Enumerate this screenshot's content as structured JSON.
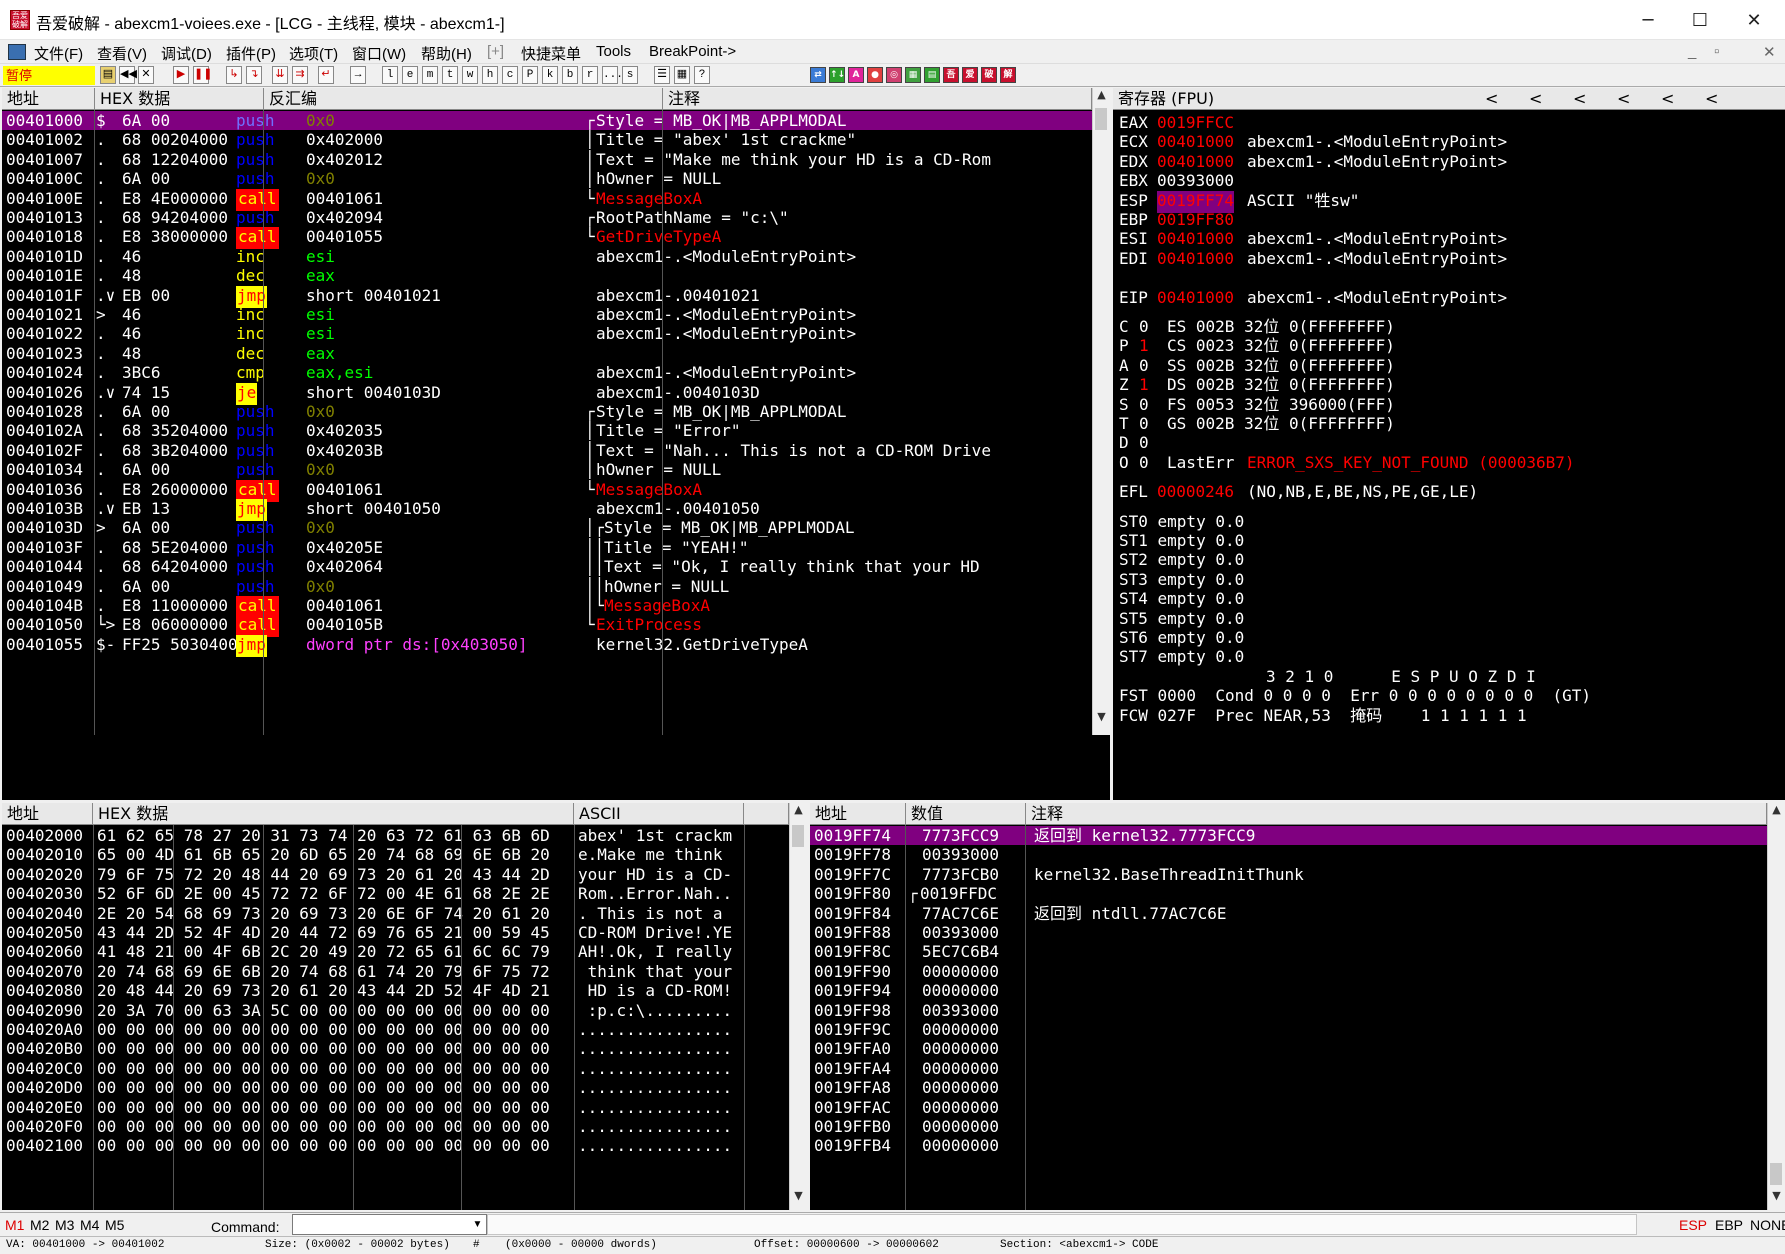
{
  "window": {
    "title": "吾爱破解 - abexcm1-voiees.exe - [LCG - 主线程, 模块 - abexcm1-]",
    "icon_text": "吾爱\n破解",
    "min": "─",
    "max": "☐",
    "close": "✕"
  },
  "menu": {
    "items": [
      "文件(F)",
      "查看(V)",
      "调试(D)",
      "插件(P)",
      "选项(T)",
      "窗口(W)",
      "帮助(H)",
      "[+]",
      "快捷菜单",
      "Tools",
      "BreakPoint->"
    ],
    "mdi_min": "_",
    "mdi_restore": "▫",
    "mdi_close": "✕"
  },
  "toolbar": {
    "status": "暂停",
    "letter_buttons": [
      "l",
      "e",
      "m",
      "t",
      "w",
      "h",
      "c",
      "P",
      "k",
      "b",
      "r",
      "...",
      "s"
    ],
    "plugin_labels": [
      "A",
      "吾",
      "爱",
      "破",
      "解"
    ]
  },
  "disasm": {
    "headers": [
      "地址",
      "HEX 数据",
      "反汇编",
      "注释"
    ],
    "rows": [
      {
        "addr": "00401000",
        "mark": "$",
        "hex": "6A 00",
        "mn": "push",
        "op": "0x0",
        "cm": "Style = MB_OK|MB_APPLMODAL",
        "br": "┌"
      },
      {
        "addr": "00401002",
        "mark": ".",
        "hex": "68 00204000",
        "mn": "push",
        "op": "0x402000",
        "cm": "Title = \"abex' 1st crackme\"",
        "br": "│"
      },
      {
        "addr": "00401007",
        "mark": ".",
        "hex": "68 12204000",
        "mn": "push",
        "op": "0x402012",
        "cm": "Text = \"Make me think your HD is a CD-Rom",
        "br": "│"
      },
      {
        "addr": "0040100C",
        "mark": ".",
        "hex": "6A 00",
        "mn": "push",
        "op": "0x0",
        "cm": "hOwner = NULL",
        "br": "│"
      },
      {
        "addr": "0040100E",
        "mark": ".",
        "hex": "E8 4E000000",
        "mn": "call",
        "op": "00401061",
        "cm": "MessageBoxA",
        "br": "└"
      },
      {
        "addr": "00401013",
        "mark": ".",
        "hex": "68 94204000",
        "mn": "push",
        "op": "0x402094",
        "cm": "RootPathName = \"c:\\\"",
        "br": "┌"
      },
      {
        "addr": "00401018",
        "mark": ".",
        "hex": "E8 38000000",
        "mn": "call",
        "op": "00401055",
        "cm": "GetDriveTypeA",
        "br": "└"
      },
      {
        "addr": "0040101D",
        "mark": ".",
        "hex": "46",
        "mn": "inc",
        "op": "esi",
        "cm": "abexcm1-.<ModuleEntryPoint>",
        "br": ""
      },
      {
        "addr": "0040101E",
        "mark": ".",
        "hex": "48",
        "mn": "dec",
        "op": "eax",
        "cm": "",
        "br": ""
      },
      {
        "addr": "0040101F",
        "mark": ".∨",
        "hex": "EB 00",
        "mn": "jmp",
        "op": "short 00401021",
        "cm": "abexcm1-.00401021",
        "br": ""
      },
      {
        "addr": "00401021",
        "mark": ">",
        "hex": "46",
        "mn": "inc",
        "op": "esi",
        "cm": "abexcm1-.<ModuleEntryPoint>",
        "br": ""
      },
      {
        "addr": "00401022",
        "mark": ".",
        "hex": "46",
        "mn": "inc",
        "op": "esi",
        "cm": "abexcm1-.<ModuleEntryPoint>",
        "br": ""
      },
      {
        "addr": "00401023",
        "mark": ".",
        "hex": "48",
        "mn": "dec",
        "op": "eax",
        "cm": "",
        "br": ""
      },
      {
        "addr": "00401024",
        "mark": ".",
        "hex": "3BC6",
        "mn": "cmp",
        "op": "eax,esi",
        "cm": "abexcm1-.<ModuleEntryPoint>",
        "br": ""
      },
      {
        "addr": "00401026",
        "mark": ".∨",
        "hex": "74 15",
        "mn": "je",
        "op": "short 0040103D",
        "cm": "abexcm1-.0040103D",
        "br": ""
      },
      {
        "addr": "00401028",
        "mark": ".",
        "hex": "6A 00",
        "mn": "push",
        "op": "0x0",
        "cm": "Style = MB_OK|MB_APPLMODAL",
        "br": "┌"
      },
      {
        "addr": "0040102A",
        "mark": ".",
        "hex": "68 35204000",
        "mn": "push",
        "op": "0x402035",
        "cm": "Title = \"Error\"",
        "br": "│"
      },
      {
        "addr": "0040102F",
        "mark": ".",
        "hex": "68 3B204000",
        "mn": "push",
        "op": "0x40203B",
        "cm": "Text = \"Nah... This is not a CD-ROM Drive",
        "br": "│"
      },
      {
        "addr": "00401034",
        "mark": ".",
        "hex": "6A 00",
        "mn": "push",
        "op": "0x0",
        "cm": "hOwner = NULL",
        "br": "│"
      },
      {
        "addr": "00401036",
        "mark": ".",
        "hex": "E8 26000000",
        "mn": "call",
        "op": "00401061",
        "cm": "MessageBoxA",
        "br": "└"
      },
      {
        "addr": "0040103B",
        "mark": ".∨",
        "hex": "EB 13",
        "mn": "jmp",
        "op": "short 00401050",
        "cm": "abexcm1-.00401050",
        "br": ""
      },
      {
        "addr": "0040103D",
        "mark": ">",
        "hex": "6A 00",
        "mn": "push",
        "op": "0x0",
        "cm": "Style = MB_OK|MB_APPLMODAL",
        "br": "│┌"
      },
      {
        "addr": "0040103F",
        "mark": ".",
        "hex": "68 5E204000",
        "mn": "push",
        "op": "0x40205E",
        "cm": "Title = \"YEAH!\"",
        "br": "││"
      },
      {
        "addr": "00401044",
        "mark": ".",
        "hex": "68 64204000",
        "mn": "push",
        "op": "0x402064",
        "cm": "Text = \"Ok, I really think that your HD",
        "br": "││"
      },
      {
        "addr": "00401049",
        "mark": ".",
        "hex": "6A 00",
        "mn": "push",
        "op": "0x0",
        "cm": "hOwner = NULL",
        "br": "││"
      },
      {
        "addr": "0040104B",
        "mark": ".",
        "hex": "E8 11000000",
        "mn": "call",
        "op": "00401061",
        "cm": "MessageBoxA",
        "br": "│└"
      },
      {
        "addr": "00401050",
        "mark": "└>",
        "hex": "E8 06000000",
        "mn": "call",
        "op": "0040105B",
        "cm": "ExitProcess",
        "br": "└"
      },
      {
        "addr": "00401055",
        "mark": "$-",
        "hex": "FF25 50304000",
        "mn": "jmp",
        "op": "dword ptr ds:[0x403050]",
        "cm": "kernel32.GetDriveTypeA",
        "br": ""
      }
    ]
  },
  "registers": {
    "header": "寄存器 (FPU)",
    "arrows": [
      "<",
      "<",
      "<",
      "<",
      "<",
      "<"
    ],
    "lines": [
      {
        "n": "EAX",
        "v": "0019FFCC",
        "d": "",
        "red": true
      },
      {
        "n": "ECX",
        "v": "00401000",
        "d": "abexcm1-.<ModuleEntryPoint>",
        "red": true
      },
      {
        "n": "EDX",
        "v": "00401000",
        "d": "abexcm1-.<ModuleEntryPoint>",
        "red": true
      },
      {
        "n": "EBX",
        "v": "00393000",
        "d": "",
        "red": false
      },
      {
        "n": "ESP",
        "v": "0019FF74",
        "d": "ASCII \"牲sw\"",
        "red": true,
        "hl": true
      },
      {
        "n": "EBP",
        "v": "0019FF80",
        "d": "",
        "red": true
      },
      {
        "n": "ESI",
        "v": "00401000",
        "d": "abexcm1-.<ModuleEntryPoint>",
        "red": true
      },
      {
        "n": "EDI",
        "v": "00401000",
        "d": "abexcm1-.<ModuleEntryPoint>",
        "red": true
      },
      {
        "n": "",
        "v": "",
        "d": "",
        "red": false
      },
      {
        "n": "EIP",
        "v": "00401000",
        "d": "abexcm1-.<ModuleEntryPoint>",
        "red": true
      }
    ],
    "flags": [
      {
        "f": "C",
        "b": "0",
        "red": false,
        "seg": "ES 002B 32位 0(FFFFFFFF)"
      },
      {
        "f": "P",
        "b": "1",
        "red": true,
        "seg": "CS 0023 32位 0(FFFFFFFF)"
      },
      {
        "f": "A",
        "b": "0",
        "red": false,
        "seg": "SS 002B 32位 0(FFFFFFFF)"
      },
      {
        "f": "Z",
        "b": "1",
        "red": true,
        "seg": "DS 002B 32位 0(FFFFFFFF)"
      },
      {
        "f": "S",
        "b": "0",
        "red": false,
        "seg": "FS 0053 32位 396000(FFF)"
      },
      {
        "f": "T",
        "b": "0",
        "red": false,
        "seg": "GS 002B 32位 0(FFFFFFFF)"
      },
      {
        "f": "D",
        "b": "0",
        "red": false,
        "seg": ""
      },
      {
        "f": "O",
        "b": "0",
        "red": false,
        "seg": ""
      }
    ],
    "lasterr_label": "LastErr",
    "lasterr_value": "ERROR_SXS_KEY_NOT_FOUND (000036B7)",
    "efl_label": "EFL",
    "efl_value": "00000246",
    "efl_desc": "(NO,NB,E,BE,NS,PE,GE,LE)",
    "st": [
      "ST0 empty 0.0",
      "ST1 empty 0.0",
      "ST2 empty 0.0",
      "ST3 empty 0.0",
      "ST4 empty 0.0",
      "ST5 empty 0.0",
      "ST6 empty 0.0",
      "ST7 empty 0.0"
    ],
    "fpu_bits": "3 2 1 0      E S P U O Z D I",
    "fst": "FST 0000  Cond 0 0 0 0  Err 0 0 0 0 0 0 0 0  (GT)",
    "fcw": "FCW 027F  Prec NEAR,53  掩码    1 1 1 1 1 1"
  },
  "dump": {
    "headers": [
      "地址",
      "HEX 数据",
      "ASCII"
    ],
    "rows": [
      {
        "a": "00402000",
        "h": "61 62 65 78 27 20 31 73 74 20 63 72 61 63 6B 6D",
        "s": "abex' 1st crackm"
      },
      {
        "a": "00402010",
        "h": "65 00 4D 61 6B 65 20 6D 65 20 74 68 69 6E 6B 20",
        "s": "e.Make me think "
      },
      {
        "a": "00402020",
        "h": "79 6F 75 72 20 48 44 20 69 73 20 61 20 43 44 2D",
        "s": "your HD is a CD-"
      },
      {
        "a": "00402030",
        "h": "52 6F 6D 2E 00 45 72 72 6F 72 00 4E 61 68 2E 2E",
        "s": "Rom..Error.Nah.."
      },
      {
        "a": "00402040",
        "h": "2E 20 54 68 69 73 20 69 73 20 6E 6F 74 20 61 20",
        "s": ". This is not a "
      },
      {
        "a": "00402050",
        "h": "43 44 2D 52 4F 4D 20 44 72 69 76 65 21 00 59 45",
        "s": "CD-ROM Drive!.YE"
      },
      {
        "a": "00402060",
        "h": "41 48 21 00 4F 6B 2C 20 49 20 72 65 61 6C 6C 79",
        "s": "AH!.Ok, I really"
      },
      {
        "a": "00402070",
        "h": "20 74 68 69 6E 6B 20 74 68 61 74 20 79 6F 75 72",
        "s": " think that your"
      },
      {
        "a": "00402080",
        "h": "20 48 44 20 69 73 20 61 20 43 44 2D 52 4F 4D 21",
        "s": " HD is a CD-ROM!"
      },
      {
        "a": "00402090",
        "h": "20 3A 70 00 63 3A 5C 00 00 00 00 00 00 00 00 00",
        "s": " :p.c:\\........."
      },
      {
        "a": "004020A0",
        "h": "00 00 00 00 00 00 00 00 00 00 00 00 00 00 00 00",
        "s": "................"
      },
      {
        "a": "004020B0",
        "h": "00 00 00 00 00 00 00 00 00 00 00 00 00 00 00 00",
        "s": "................"
      },
      {
        "a": "004020C0",
        "h": "00 00 00 00 00 00 00 00 00 00 00 00 00 00 00 00",
        "s": "................"
      },
      {
        "a": "004020D0",
        "h": "00 00 00 00 00 00 00 00 00 00 00 00 00 00 00 00",
        "s": "................"
      },
      {
        "a": "004020E0",
        "h": "00 00 00 00 00 00 00 00 00 00 00 00 00 00 00 00",
        "s": "................"
      },
      {
        "a": "004020F0",
        "h": "00 00 00 00 00 00 00 00 00 00 00 00 00 00 00 00",
        "s": "................"
      },
      {
        "a": "00402100",
        "h": "00 00 00 00 00 00 00 00 00 00 00 00 00 00 00 00",
        "s": "................"
      }
    ]
  },
  "stack": {
    "headers": [
      "地址",
      "数值",
      "注释"
    ],
    "rows": [
      {
        "a": "0019FF74",
        "v": "7773FCC9",
        "c": "返回到 kernel32.7773FCC9",
        "m": ""
      },
      {
        "a": "0019FF78",
        "v": "00393000",
        "c": "",
        "m": ""
      },
      {
        "a": "0019FF7C",
        "v": "7773FCB0",
        "c": "kernel32.BaseThreadInitThunk",
        "m": ""
      },
      {
        "a": "0019FF80",
        "v": "0019FFDC",
        "c": "",
        "m": "┌"
      },
      {
        "a": "0019FF84",
        "v": "77AC7C6E",
        "c": "返回到 ntdll.77AC7C6E",
        "m": ""
      },
      {
        "a": "0019FF88",
        "v": "00393000",
        "c": "",
        "m": ""
      },
      {
        "a": "0019FF8C",
        "v": "5EC7C6B4",
        "c": "",
        "m": ""
      },
      {
        "a": "0019FF90",
        "v": "00000000",
        "c": "",
        "m": ""
      },
      {
        "a": "0019FF94",
        "v": "00000000",
        "c": "",
        "m": ""
      },
      {
        "a": "0019FF98",
        "v": "00393000",
        "c": "",
        "m": ""
      },
      {
        "a": "0019FF9C",
        "v": "00000000",
        "c": "",
        "m": ""
      },
      {
        "a": "0019FFA0",
        "v": "00000000",
        "c": "",
        "m": ""
      },
      {
        "a": "0019FFA4",
        "v": "00000000",
        "c": "",
        "m": ""
      },
      {
        "a": "0019FFA8",
        "v": "00000000",
        "c": "",
        "m": ""
      },
      {
        "a": "0019FFAC",
        "v": "00000000",
        "c": "",
        "m": ""
      },
      {
        "a": "0019FFB0",
        "v": "00000000",
        "c": "",
        "m": ""
      },
      {
        "a": "0019FFB4",
        "v": "00000000",
        "c": "",
        "m": ""
      }
    ]
  },
  "cmd": {
    "tabs": [
      "M1",
      "M2",
      "M3",
      "M4",
      "M5"
    ],
    "label": "Command:",
    "value": "",
    "right": [
      "ESP",
      "EBP",
      "NONE"
    ]
  },
  "status": {
    "va": "VA: 00401000 -> 00401002",
    "size": "Size: (0x0002 - 00002 bytes)",
    "hash": "#",
    "dwords": "(0x0000 - 00000 dwords)",
    "offset": "Offset: 00000600 -> 00000602",
    "section": "Section: <abexcm1-> CODE"
  },
  "colors": {
    "selected_row": "#800080",
    "mnemonic_push": "#0000ff",
    "mnemonic_call_bg": "#ff0000",
    "mnemonic_call_fg": "#ffff00",
    "mnemonic_jmp_bg": "#ffff00",
    "mnemonic_jmp_fg": "#ff0000",
    "mnemonic_inc": "#ffff00",
    "operand_const": "#808000",
    "operand_reg": "#00ff00",
    "text": "#ffffff",
    "changed_reg": "#ff0000",
    "api_comment": "#ff0000"
  }
}
